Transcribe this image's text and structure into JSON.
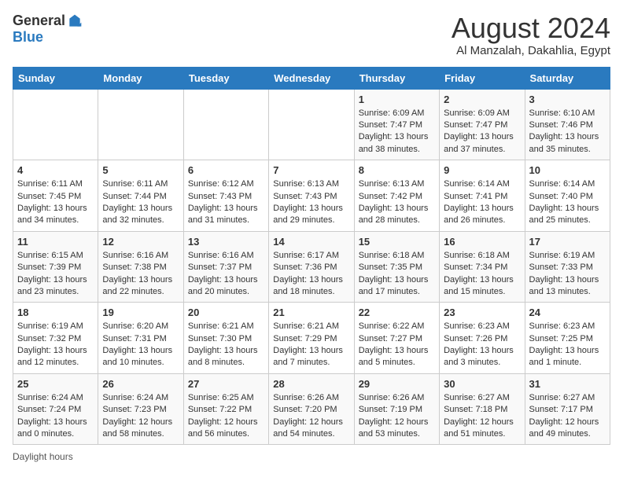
{
  "logo": {
    "general": "General",
    "blue": "Blue"
  },
  "title": "August 2024",
  "subtitle": "Al Manzalah, Dakahlia, Egypt",
  "days_header": [
    "Sunday",
    "Monday",
    "Tuesday",
    "Wednesday",
    "Thursday",
    "Friday",
    "Saturday"
  ],
  "weeks": [
    [
      {
        "day": "",
        "info": ""
      },
      {
        "day": "",
        "info": ""
      },
      {
        "day": "",
        "info": ""
      },
      {
        "day": "",
        "info": ""
      },
      {
        "day": "1",
        "info": "Sunrise: 6:09 AM\nSunset: 7:47 PM\nDaylight: 13 hours\nand 38 minutes."
      },
      {
        "day": "2",
        "info": "Sunrise: 6:09 AM\nSunset: 7:47 PM\nDaylight: 13 hours\nand 37 minutes."
      },
      {
        "day": "3",
        "info": "Sunrise: 6:10 AM\nSunset: 7:46 PM\nDaylight: 13 hours\nand 35 minutes."
      }
    ],
    [
      {
        "day": "4",
        "info": "Sunrise: 6:11 AM\nSunset: 7:45 PM\nDaylight: 13 hours\nand 34 minutes."
      },
      {
        "day": "5",
        "info": "Sunrise: 6:11 AM\nSunset: 7:44 PM\nDaylight: 13 hours\nand 32 minutes."
      },
      {
        "day": "6",
        "info": "Sunrise: 6:12 AM\nSunset: 7:43 PM\nDaylight: 13 hours\nand 31 minutes."
      },
      {
        "day": "7",
        "info": "Sunrise: 6:13 AM\nSunset: 7:43 PM\nDaylight: 13 hours\nand 29 minutes."
      },
      {
        "day": "8",
        "info": "Sunrise: 6:13 AM\nSunset: 7:42 PM\nDaylight: 13 hours\nand 28 minutes."
      },
      {
        "day": "9",
        "info": "Sunrise: 6:14 AM\nSunset: 7:41 PM\nDaylight: 13 hours\nand 26 minutes."
      },
      {
        "day": "10",
        "info": "Sunrise: 6:14 AM\nSunset: 7:40 PM\nDaylight: 13 hours\nand 25 minutes."
      }
    ],
    [
      {
        "day": "11",
        "info": "Sunrise: 6:15 AM\nSunset: 7:39 PM\nDaylight: 13 hours\nand 23 minutes."
      },
      {
        "day": "12",
        "info": "Sunrise: 6:16 AM\nSunset: 7:38 PM\nDaylight: 13 hours\nand 22 minutes."
      },
      {
        "day": "13",
        "info": "Sunrise: 6:16 AM\nSunset: 7:37 PM\nDaylight: 13 hours\nand 20 minutes."
      },
      {
        "day": "14",
        "info": "Sunrise: 6:17 AM\nSunset: 7:36 PM\nDaylight: 13 hours\nand 18 minutes."
      },
      {
        "day": "15",
        "info": "Sunrise: 6:18 AM\nSunset: 7:35 PM\nDaylight: 13 hours\nand 17 minutes."
      },
      {
        "day": "16",
        "info": "Sunrise: 6:18 AM\nSunset: 7:34 PM\nDaylight: 13 hours\nand 15 minutes."
      },
      {
        "day": "17",
        "info": "Sunrise: 6:19 AM\nSunset: 7:33 PM\nDaylight: 13 hours\nand 13 minutes."
      }
    ],
    [
      {
        "day": "18",
        "info": "Sunrise: 6:19 AM\nSunset: 7:32 PM\nDaylight: 13 hours\nand 12 minutes."
      },
      {
        "day": "19",
        "info": "Sunrise: 6:20 AM\nSunset: 7:31 PM\nDaylight: 13 hours\nand 10 minutes."
      },
      {
        "day": "20",
        "info": "Sunrise: 6:21 AM\nSunset: 7:30 PM\nDaylight: 13 hours\nand 8 minutes."
      },
      {
        "day": "21",
        "info": "Sunrise: 6:21 AM\nSunset: 7:29 PM\nDaylight: 13 hours\nand 7 minutes."
      },
      {
        "day": "22",
        "info": "Sunrise: 6:22 AM\nSunset: 7:27 PM\nDaylight: 13 hours\nand 5 minutes."
      },
      {
        "day": "23",
        "info": "Sunrise: 6:23 AM\nSunset: 7:26 PM\nDaylight: 13 hours\nand 3 minutes."
      },
      {
        "day": "24",
        "info": "Sunrise: 6:23 AM\nSunset: 7:25 PM\nDaylight: 13 hours\nand 1 minute."
      }
    ],
    [
      {
        "day": "25",
        "info": "Sunrise: 6:24 AM\nSunset: 7:24 PM\nDaylight: 13 hours\nand 0 minutes."
      },
      {
        "day": "26",
        "info": "Sunrise: 6:24 AM\nSunset: 7:23 PM\nDaylight: 12 hours\nand 58 minutes."
      },
      {
        "day": "27",
        "info": "Sunrise: 6:25 AM\nSunset: 7:22 PM\nDaylight: 12 hours\nand 56 minutes."
      },
      {
        "day": "28",
        "info": "Sunrise: 6:26 AM\nSunset: 7:20 PM\nDaylight: 12 hours\nand 54 minutes."
      },
      {
        "day": "29",
        "info": "Sunrise: 6:26 AM\nSunset: 7:19 PM\nDaylight: 12 hours\nand 53 minutes."
      },
      {
        "day": "30",
        "info": "Sunrise: 6:27 AM\nSunset: 7:18 PM\nDaylight: 12 hours\nand 51 minutes."
      },
      {
        "day": "31",
        "info": "Sunrise: 6:27 AM\nSunset: 7:17 PM\nDaylight: 12 hours\nand 49 minutes."
      }
    ]
  ],
  "footer": "Daylight hours"
}
